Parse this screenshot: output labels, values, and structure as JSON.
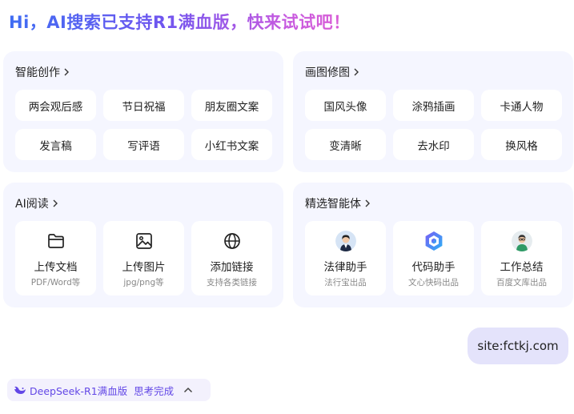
{
  "headline": "Hi，AI搜索已支持R1满血版，快来试试吧！",
  "panels": {
    "creation": {
      "title": "智能创作",
      "items": [
        "两会观后感",
        "节日祝福",
        "朋友圈文案",
        "发言稿",
        "写评语",
        "小红书文案"
      ]
    },
    "image": {
      "title": "画图修图",
      "items": [
        "国风头像",
        "涂鸦插画",
        "卡通人物",
        "变清晰",
        "去水印",
        "换风格"
      ]
    },
    "reading": {
      "title": "AI阅读",
      "cards": [
        {
          "icon": "folder-icon",
          "title": "上传文档",
          "subtitle": "PDF/Word等"
        },
        {
          "icon": "image-icon",
          "title": "上传图片",
          "subtitle": "jpg/png等"
        },
        {
          "icon": "globe-icon",
          "title": "添加链接",
          "subtitle": "支持各类链接"
        }
      ]
    },
    "agents": {
      "title": "精选智能体",
      "cards": [
        {
          "icon": "lawyer-avatar",
          "title": "法律助手",
          "subtitle": "法行宝出品"
        },
        {
          "icon": "code-assistant-icon",
          "title": "代码助手",
          "subtitle": "文心快码出品"
        },
        {
          "icon": "worker-avatar",
          "title": "工作总结",
          "subtitle": "百度文库出品"
        }
      ]
    }
  },
  "chat": {
    "user_message": "site:fctkj.com"
  },
  "status_bar": {
    "model": "DeepSeek-R1满血版",
    "state": "思考完成"
  },
  "colors": {
    "accent": "#6247e6",
    "panel_bg": "#f5f6ff",
    "bubble_bg": "#e4e3fb"
  }
}
